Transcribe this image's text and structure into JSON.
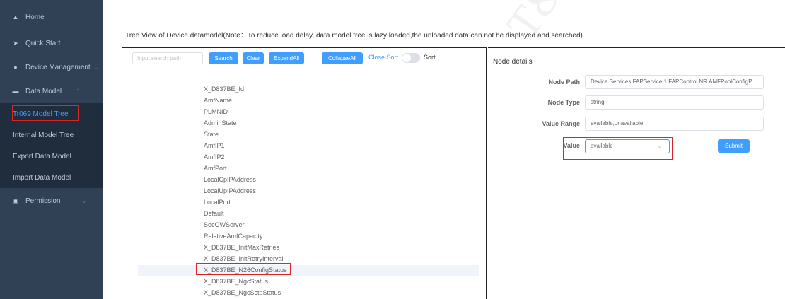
{
  "sidebar": {
    "items": [
      {
        "label": "Home"
      },
      {
        "label": "Quick Start"
      },
      {
        "label": "Device Management"
      },
      {
        "label": "Data Model"
      },
      {
        "label": "Permission"
      }
    ],
    "submenu": [
      {
        "label": "Tr069 Model Tree"
      },
      {
        "label": "Internal Model Tree"
      },
      {
        "label": "Export Data Model"
      },
      {
        "label": "Import Data Model"
      }
    ]
  },
  "header": {
    "text": "Tree View of Device datamodel(Note：To reduce load delay, data model tree is lazy loaded,the unloaded data can not be displayed and searched)"
  },
  "toolbar": {
    "search_placeholder": "Input search path",
    "search_label": "Search",
    "clear_label": "Clear",
    "expand_label": "ExpandAll",
    "collapse_label": "CollapseAll",
    "close_sort_label": "Close Sort",
    "sort_label": "Sort"
  },
  "tree": {
    "items": [
      "X_D837BE_Id",
      "AmfName",
      "PLMNID",
      "AdminState",
      "State",
      "AmfIP1",
      "AmfIP2",
      "AmfPort",
      "LocalCpIPAddress",
      "LocalUpIPAddress",
      "LocalPort",
      "Default",
      "SecGWServer",
      "RelativeAmfCapacity",
      "X_D837BE_InitMaxRetries",
      "X_D837BE_InitRetryInterval",
      "X_D837BE_N26ConfigStatus",
      "X_D837BE_NgcStatus",
      "X_D837BE_NgcSctpStatus"
    ]
  },
  "details": {
    "title": "Node details",
    "path_label": "Node Path",
    "path_value": "Device.Services.FAPService.1.FAPControl.NR.AMFPoolConfigP...",
    "type_label": "Node Type",
    "type_value": "string",
    "range_label": "Value Range",
    "range_value": "available,unavailable",
    "value_label": "Value",
    "value_selected": "available",
    "submit_label": "Submit"
  },
  "colors": {
    "sidebar_bg": "#304156",
    "submenu_bg": "#1f2d3d",
    "primary": "#409eff",
    "highlight_border": "#d9262b"
  }
}
